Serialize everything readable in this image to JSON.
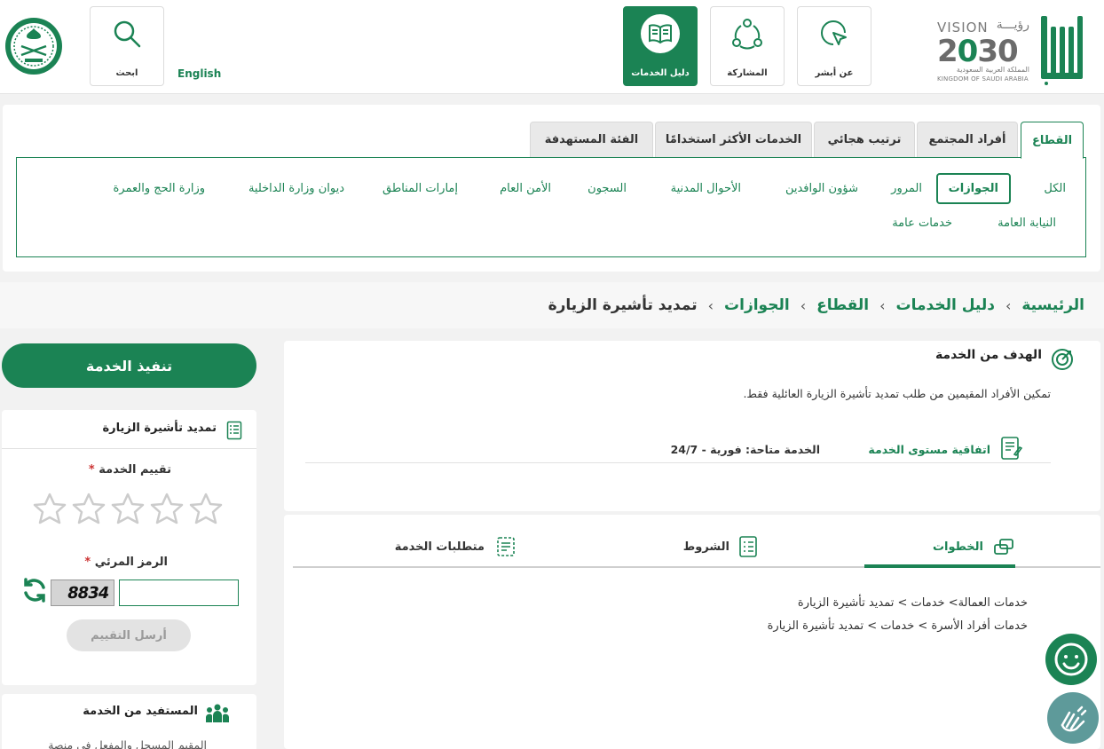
{
  "header": {
    "nav": [
      {
        "label": "عن أبشر"
      },
      {
        "label": "المشاركة"
      },
      {
        "label": "دليل الخدمات"
      }
    ],
    "search_label": "ابحث",
    "language": "English",
    "vision": {
      "word": "VISION",
      "ar": "رؤيـــة",
      "year": "2030",
      "kingdom_ar": "المملكة العربية السعودية",
      "kingdom_en": "KINGDOM OF SAUDI ARABIA"
    }
  },
  "sector": {
    "tabs": [
      "القطاع",
      "أفراد المجتمع",
      "ترتيب هجائي",
      "الخدمات الأكثر استخدامًا",
      "الفئة المستهدفة"
    ],
    "categories": [
      "الكل",
      "الجوازات",
      "المرور",
      "شؤون الوافدين",
      "الأحوال المدنية",
      "السجون",
      "الأمن العام",
      "إمارات المناطق",
      "ديوان وزارة الداخلية",
      "وزارة الحج والعمرة",
      "النيابة العامة",
      "خدمات عامة"
    ]
  },
  "breadcrumb": [
    "الرئيسية",
    "دليل الخدمات",
    "القطاع",
    "الجوازات",
    "تمديد تأشيرة الزيارة"
  ],
  "goal": {
    "title": "الهدف من الخدمة",
    "text": "تمكين الأفراد المقيمين من طلب تمديد تأشيرة الزيارة العائلية فقط.",
    "sla": "اتفاقية مستوى الخدمة",
    "availability": "الخدمة متاحة: فورية - 24/7"
  },
  "steps_tabs": [
    "الخطوات",
    "الشروط",
    "متطلبات الخدمة"
  ],
  "steps": [
    "خدمات العمالة> خدمات > تمديد تأشيرة الزيارة",
    "خدمات أفراد الأسرة > خدمات > تمديد تأشيرة الزيارة"
  ],
  "sidebar": {
    "execute": "تنفيذ الخدمة",
    "card_title": "تمديد تأشيرة الزيارة",
    "rating_label": "تقييم الخدمة",
    "captcha_label": "الرمز المرئي",
    "required_mark": "*",
    "captcha_text": "8834",
    "send": "أرسل التقييم",
    "rating_value": 0,
    "beneficiary_title": "المستفيد من الخدمة",
    "beneficiary_text": "المقيم المسجل والمفعل في منصة"
  },
  "colors": {
    "primary": "#1b8354",
    "star": "#cccccc"
  }
}
